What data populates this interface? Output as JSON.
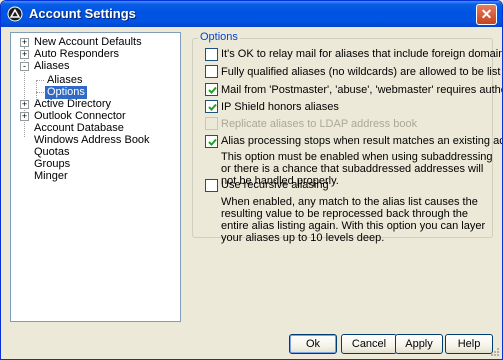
{
  "window": {
    "title": "Account Settings"
  },
  "tree": {
    "items": [
      {
        "label": "New Account Defaults",
        "expander": "+"
      },
      {
        "label": "Auto Responders",
        "expander": "+"
      },
      {
        "label": "Aliases",
        "expander": "-"
      },
      {
        "label": "Aliases",
        "expander": ""
      },
      {
        "label": "Options",
        "expander": "",
        "selected": true
      },
      {
        "label": "Active Directory",
        "expander": "+"
      },
      {
        "label": "Outlook Connector",
        "expander": "+"
      },
      {
        "label": "Account Database",
        "expander": ""
      },
      {
        "label": "Windows Address Book",
        "expander": ""
      },
      {
        "label": "Quotas",
        "expander": ""
      },
      {
        "label": "Groups",
        "expander": ""
      },
      {
        "label": "Minger",
        "expander": ""
      }
    ]
  },
  "options": {
    "group_title": "Options",
    "items": [
      {
        "label": "It's OK to relay mail for aliases that include foreign domains",
        "checked": false,
        "disabled": false
      },
      {
        "label": "Fully qualified aliases (no wildcards) are allowed to be list members",
        "checked": false,
        "disabled": false
      },
      {
        "label": "Mail from 'Postmaster', 'abuse', 'webmaster' requires authentication",
        "checked": true,
        "disabled": false
      },
      {
        "label": "IP Shield honors aliases",
        "checked": true,
        "disabled": false
      },
      {
        "label": "Replicate aliases to LDAP address book",
        "checked": false,
        "disabled": true
      },
      {
        "label": "Alias processing stops when result matches an existing account or list",
        "checked": true,
        "disabled": false
      },
      {
        "label": "Use recursive aliasing",
        "checked": false,
        "disabled": false
      }
    ],
    "note_stop": "This option must be enabled when using subaddressing or there is a chance that subaddressed addresses will not be handled properly.",
    "note_recursive": "When enabled, any match to the alias list causes the resulting value to be reprocessed back through the entire alias listing again.  With this option you can layer your aliases up to 10 levels deep."
  },
  "buttons": {
    "ok": "Ok",
    "cancel": "Cancel",
    "apply": "Apply",
    "help": "Help"
  }
}
